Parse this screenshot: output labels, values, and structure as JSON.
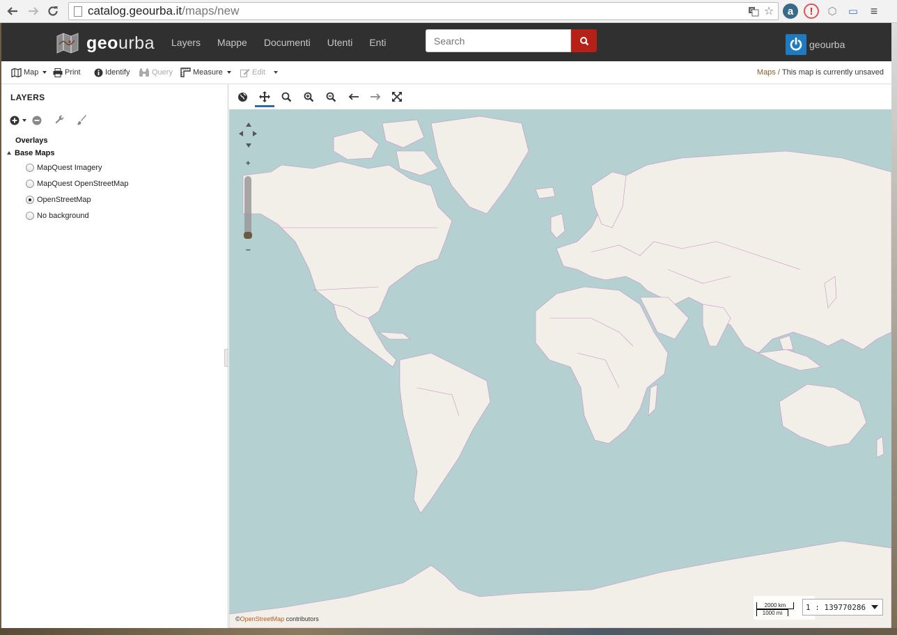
{
  "browser": {
    "url_host": "catalog.geourba.it",
    "url_path": "/maps/new"
  },
  "header": {
    "logo_bold": "geo",
    "logo_thin": "urba",
    "nav": [
      "Layers",
      "Mappe",
      "Documenti",
      "Utenti",
      "Enti"
    ],
    "search_placeholder": "Search",
    "user_name": "geourba"
  },
  "toolbar": {
    "map_label": "Map",
    "print_label": "Print",
    "identify_label": "Identify",
    "query_label": "Query",
    "measure_label": "Measure",
    "edit_label": "Edit",
    "breadcrumb_link": "Maps",
    "breadcrumb_sep": "/",
    "breadcrumb_current": "This map is currently unsaved"
  },
  "layers_panel": {
    "title": "LAYERS",
    "overlays_label": "Overlays",
    "basemaps_label": "Base Maps",
    "basemaps": [
      {
        "label": "MapQuest Imagery",
        "selected": false
      },
      {
        "label": "MapQuest OpenStreetMap",
        "selected": false
      },
      {
        "label": "OpenStreetMap",
        "selected": true
      },
      {
        "label": "No background",
        "selected": false
      }
    ]
  },
  "map": {
    "attribution_prefix": "©",
    "attribution_link": "OpenStreetMap",
    "attribution_suffix": "contributors",
    "scale_km": "2000 km",
    "scale_mi": "1000 mi",
    "scale_value": "1 : 139770286",
    "colors": {
      "water": "#b5d0d0",
      "land": "#f2efe9",
      "borders": "#c98fc9"
    }
  },
  "colors": {
    "header_bg": "#303030",
    "search_button": "#b52117",
    "user_avatar": "#1f7bc1",
    "breadcrumb_link": "#8b5a2b",
    "active_tool": "#2a6ea8"
  }
}
